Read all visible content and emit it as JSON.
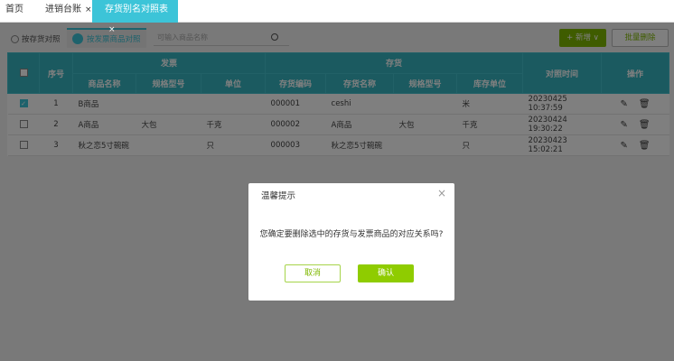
{
  "tabs": [
    {
      "label": "首页"
    },
    {
      "label": "进销台账",
      "closable": "×"
    },
    {
      "label": "存货别名对照表",
      "closable": "×",
      "active": true
    }
  ],
  "toolbar": {
    "subtabs": [
      {
        "label": "按存货对照"
      },
      {
        "label": "按发票商品对照",
        "active": true
      }
    ],
    "search_placeholder": "可输入商品名称",
    "add_label": "+ 新增 ∨",
    "batch_delete_label": "批量删除"
  },
  "table": {
    "group_headers": {
      "invoice": "发票",
      "inventory": "存货"
    },
    "headers": {
      "index": "序号",
      "product_name": "商品名称",
      "spec": "规格型号",
      "unit": "单位",
      "inv_code": "存货编码",
      "inv_name": "存货名称",
      "inv_spec": "规格型号",
      "inv_unit": "库存单位",
      "time": "对照时间",
      "ops": "操作"
    },
    "rows": [
      {
        "checked": true,
        "index": "1",
        "product_name": "B商品",
        "spec": "",
        "unit": "",
        "inv_code": "000001",
        "inv_name": "ceshi",
        "inv_spec": "",
        "inv_unit": "米",
        "time": "20230425 10:37:59"
      },
      {
        "checked": false,
        "index": "2",
        "product_name": "A商品",
        "spec": "大包",
        "unit": "千克",
        "inv_code": "000002",
        "inv_name": "A商品",
        "inv_spec": "大包",
        "inv_unit": "千克",
        "time": "20230424 19:30:22"
      },
      {
        "checked": false,
        "index": "3",
        "product_name": "秋之恋5寸碗碗",
        "spec": "",
        "unit": "只",
        "inv_code": "000003",
        "inv_name": "秋之恋5寸碗碗",
        "inv_spec": "",
        "inv_unit": "只",
        "time": "20230423 15:02:21"
      }
    ]
  },
  "dialog": {
    "title": "温馨提示",
    "close": "×",
    "message": "您确定要删除选中的存货与发票商品的对应关系吗?",
    "cancel": "取消",
    "confirm": "确认"
  },
  "colors": {
    "accent": "#3cc4d8",
    "green": "#7fb800"
  }
}
